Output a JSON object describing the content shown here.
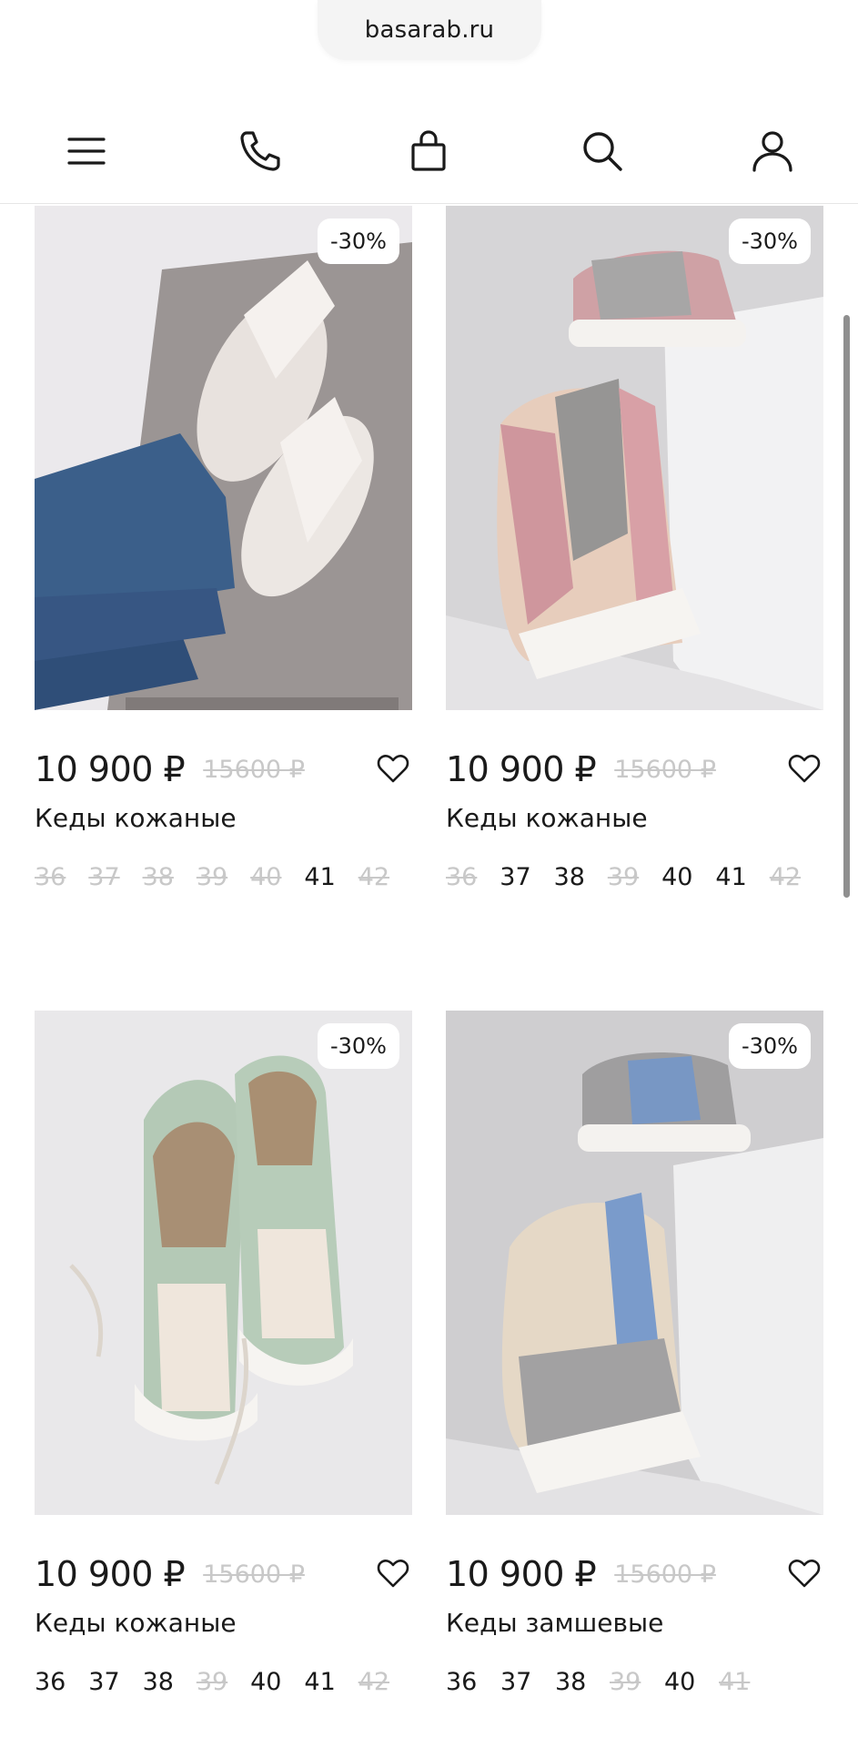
{
  "browser": {
    "url": "basarab.ru"
  },
  "nav": {
    "items": [
      {
        "icon": "menu-icon"
      },
      {
        "icon": "phone-icon"
      },
      {
        "icon": "bag-icon"
      },
      {
        "icon": "search-icon"
      },
      {
        "icon": "user-icon"
      }
    ]
  },
  "products": [
    {
      "discount": "-30%",
      "price": "10 900 ₽",
      "old_price": "15600 ₽",
      "name": "Кеды кожаные",
      "sizes": [
        {
          "label": "36",
          "available": false
        },
        {
          "label": "37",
          "available": false
        },
        {
          "label": "38",
          "available": false
        },
        {
          "label": "39",
          "available": false
        },
        {
          "label": "40",
          "available": false
        },
        {
          "label": "41",
          "available": true
        },
        {
          "label": "42",
          "available": false
        }
      ]
    },
    {
      "discount": "-30%",
      "price": "10 900 ₽",
      "old_price": "15600 ₽",
      "name": "Кеды кожаные",
      "sizes": [
        {
          "label": "36",
          "available": false
        },
        {
          "label": "37",
          "available": true
        },
        {
          "label": "38",
          "available": true
        },
        {
          "label": "39",
          "available": false
        },
        {
          "label": "40",
          "available": true
        },
        {
          "label": "41",
          "available": true
        },
        {
          "label": "42",
          "available": false
        }
      ]
    },
    {
      "discount": "-30%",
      "price": "10 900 ₽",
      "old_price": "15600 ₽",
      "name": "Кеды кожаные",
      "sizes": [
        {
          "label": "36",
          "available": true
        },
        {
          "label": "37",
          "available": true
        },
        {
          "label": "38",
          "available": true
        },
        {
          "label": "39",
          "available": false
        },
        {
          "label": "40",
          "available": true
        },
        {
          "label": "41",
          "available": true
        },
        {
          "label": "42",
          "available": false
        }
      ]
    },
    {
      "discount": "-30%",
      "price": "10 900 ₽",
      "old_price": "15600 ₽",
      "name": "Кеды замшевые",
      "sizes": [
        {
          "label": "36",
          "available": true
        },
        {
          "label": "37",
          "available": true
        },
        {
          "label": "38",
          "available": true
        },
        {
          "label": "39",
          "available": false
        },
        {
          "label": "40",
          "available": true
        },
        {
          "label": "41",
          "available": false
        }
      ]
    }
  ],
  "colors": {
    "text": "#1a1a1a",
    "muted": "#c8c8c8",
    "badge_bg": "#ffffff"
  }
}
